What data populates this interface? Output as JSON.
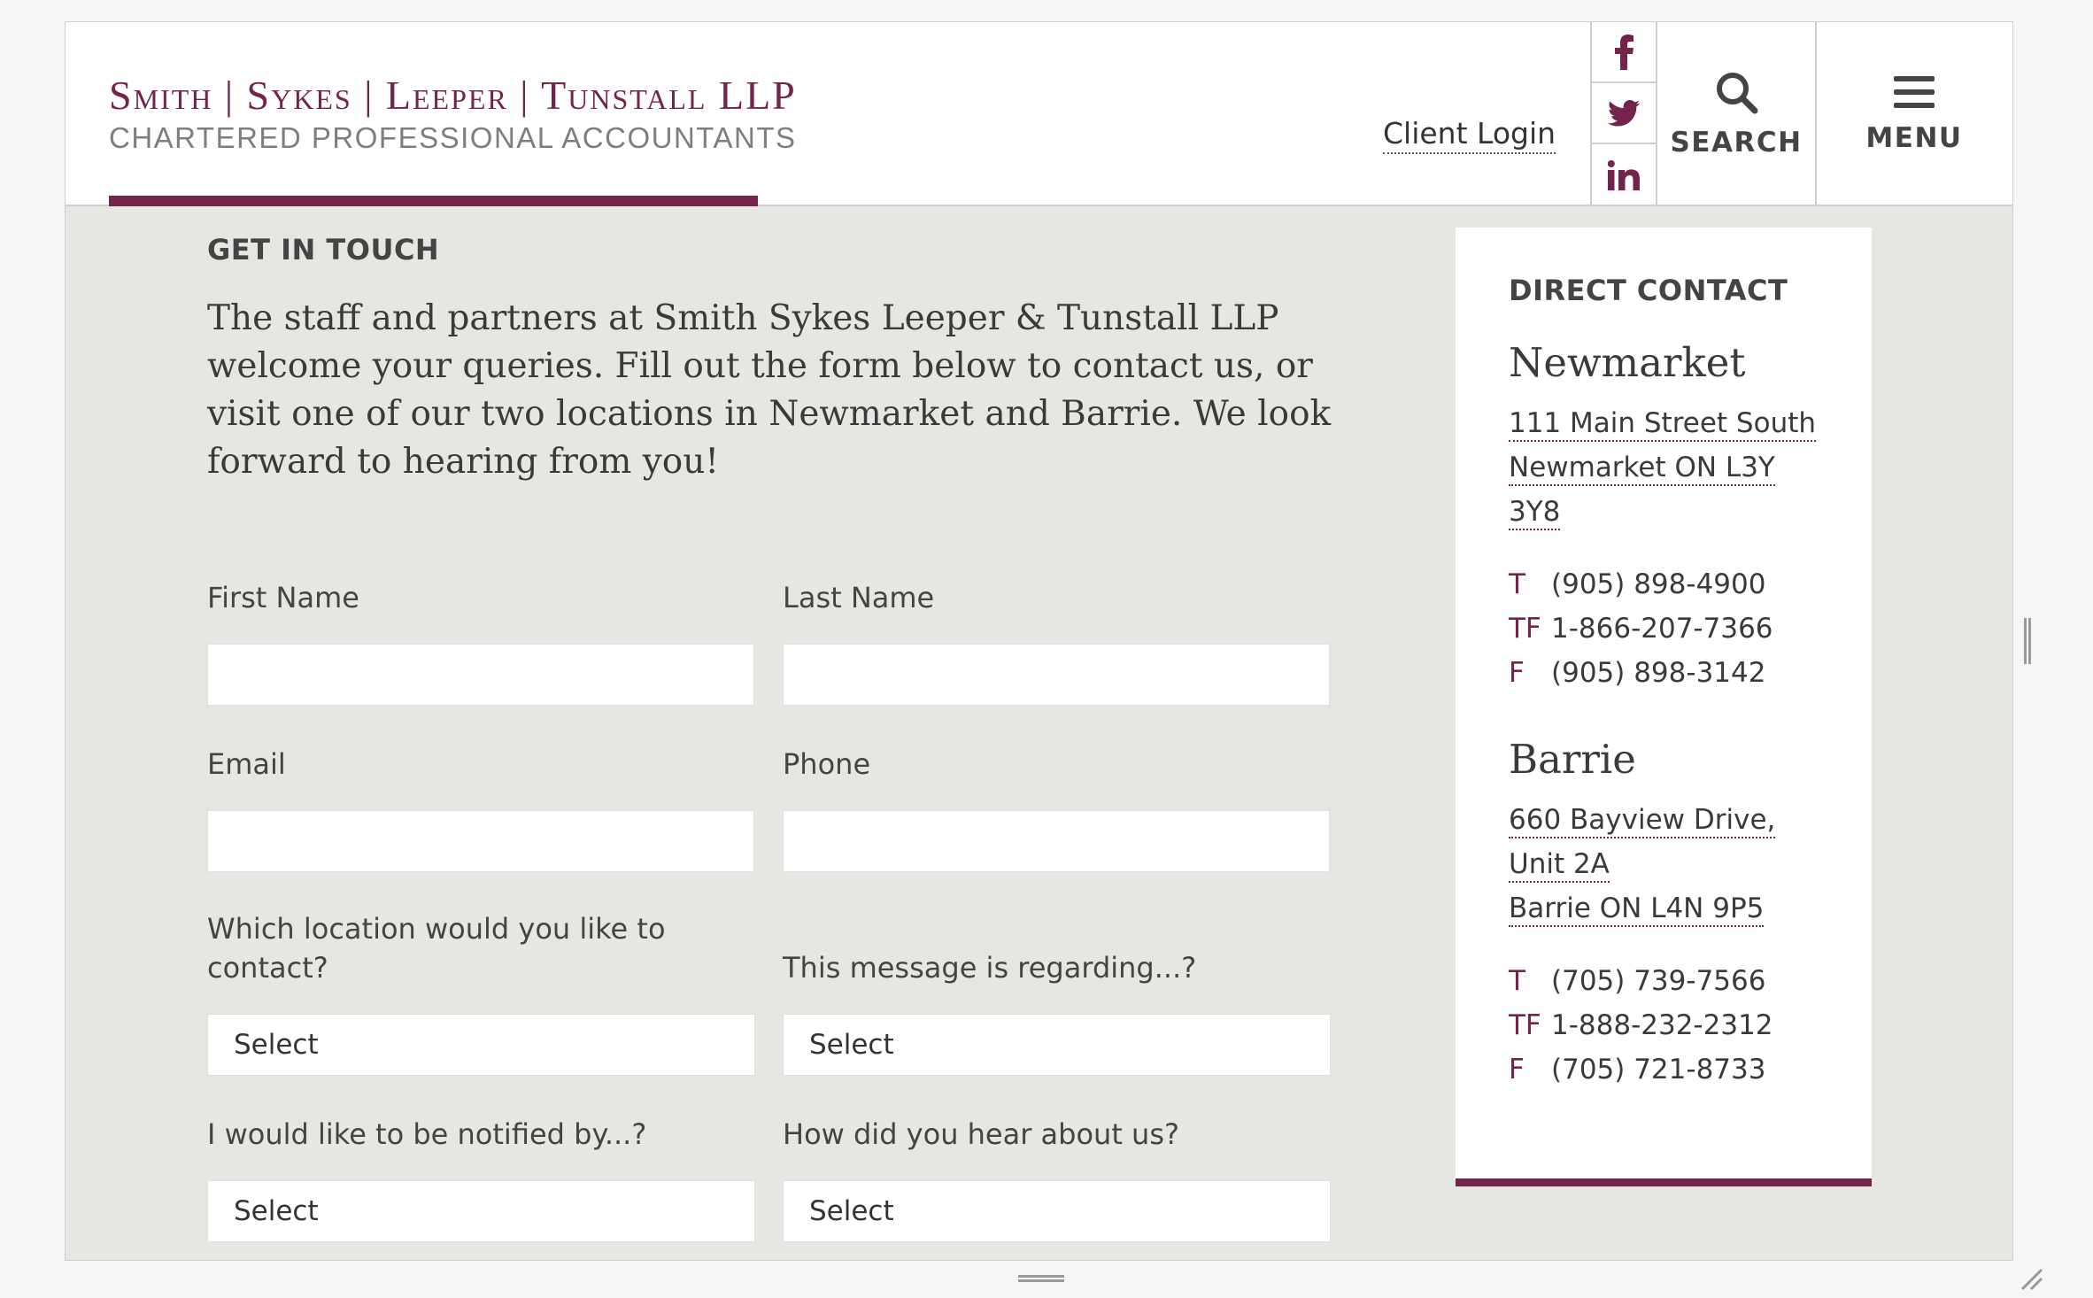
{
  "header": {
    "logo_line1": "Smith | Sykes | Leeper | Tunstall LLP",
    "logo_line2": "CHARTERED PROFESSIONAL ACCOUNTANTS",
    "client_login": "Client Login",
    "social_icons": [
      "facebook-icon",
      "twitter-icon",
      "linkedin-icon"
    ],
    "search_label": "SEARCH",
    "menu_label": "MENU"
  },
  "main": {
    "eyebrow": "GET IN TOUCH",
    "intro": "The staff and partners at Smith Sykes Leeper & Tunstall LLP welcome your queries. Fill out the form below to contact us, or visit one of our two locations in Newmarket and Barrie. We look forward to hearing from you!",
    "form": {
      "first_name_label": "First Name",
      "last_name_label": "Last Name",
      "email_label": "Email",
      "phone_label": "Phone",
      "location_label": "Which location would you like to contact?",
      "regarding_label": "This message is regarding...?",
      "notified_label": "I would like to be notified by...?",
      "hear_label": "How did you hear about us?",
      "location_value": "Select",
      "regarding_value": "Select",
      "notified_value": "Select",
      "hear_value": "Select"
    }
  },
  "sidebar": {
    "heading": "DIRECT CONTACT",
    "locations": [
      {
        "city": "Newmarket",
        "address_lines": [
          "111 Main Street South",
          "Newmarket ON L3Y",
          "3Y8"
        ],
        "phones": [
          {
            "code": "T",
            "number": "(905) 898-4900"
          },
          {
            "code": "TF",
            "number": "1-866-207-7366"
          },
          {
            "code": "F",
            "number": "(905) 898-3142"
          }
        ]
      },
      {
        "city": "Barrie",
        "address_lines": [
          "660 Bayview Drive,",
          "Unit 2A",
          "Barrie ON L4N 9P5"
        ],
        "phones": [
          {
            "code": "T",
            "number": "(705) 739-7566"
          },
          {
            "code": "TF",
            "number": "1-888-232-2312"
          },
          {
            "code": "F",
            "number": "(705) 721-8733"
          }
        ]
      }
    ]
  },
  "colors": {
    "brand": "#74234d",
    "background": "#e6e6e2",
    "text": "#3a3a3a"
  }
}
